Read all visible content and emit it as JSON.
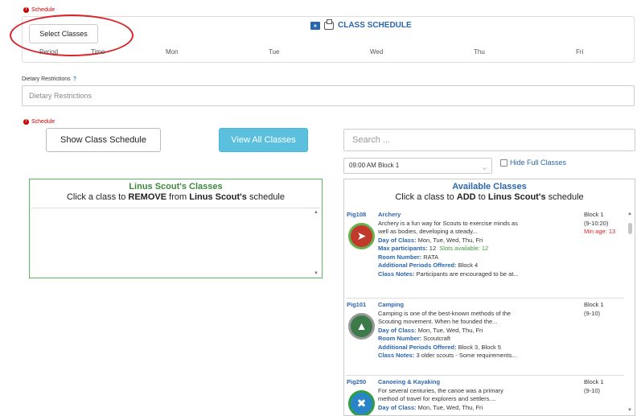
{
  "top": {
    "req_label": "Schedule",
    "select_classes": "Select Classes",
    "schedule_title": "CLASS SCHEDULE",
    "headers": [
      "Period",
      "Time",
      "Mon",
      "Tue",
      "Wed",
      "Thu",
      "Fri"
    ]
  },
  "dietary": {
    "label": "Dietary Restrictions",
    "help": "?",
    "placeholder": "Dietary Restrictions"
  },
  "schedule": {
    "req_label": "Schedule",
    "show_button": "Show Class Schedule",
    "view_all_button": "View All Classes",
    "search_placeholder": "Search ...",
    "block_select": "09:00 AM Block 1",
    "hide_full": "Hide Full Classes"
  },
  "my_classes": {
    "title": "Linus Scout's Classes",
    "sub_pre": "Click a class to ",
    "sub_verb": "REMOVE",
    "sub_mid": " from ",
    "sub_name": "Linus Scout's",
    "sub_post": " schedule"
  },
  "available": {
    "title": "Available Classes",
    "sub_pre": "Click a class to ",
    "sub_verb": "ADD",
    "sub_mid": " to ",
    "sub_name": "Linus Scout's",
    "sub_post": " schedule",
    "classes": [
      {
        "code": "Pig108",
        "name": "Archery",
        "desc1": "Archery is a fun way for Scouts to exercise minds as",
        "desc2": "well as bodies, developing a steady...",
        "day_label": "Day of Class:",
        "day_value": " Mon, Tue, Wed, Thu, Fri",
        "max_label": "Max participants:",
        "max_value": " 12",
        "slots": "Slots available: 12",
        "room_label": "Room Number:",
        "room_value": " RATA",
        "addl_label": "Additional Periods Offered:",
        "addl_value": " Block 4",
        "notes_label": "Class Notes:",
        "notes_value": " Participants are encouraged to be at...",
        "block": "Block 1",
        "time": "(9-10:20)",
        "min_age": "Min age: 13",
        "badge_color": "#c0392b",
        "ring_color": "#6ab04c"
      },
      {
        "code": "Pig101",
        "name": "Camping",
        "desc1": "Camping is one of the best-known methods of the",
        "desc2": "Scouting movement. When he founded the...",
        "day_label": "Day of Class:",
        "day_value": " Mon, Tue, Wed, Thu, Fri",
        "room_label": "Room Number:",
        "room_value": " Scoutcraft",
        "addl_label": "Additional Periods Offered:",
        "addl_value": " Block 3, Block 5",
        "notes_label": "Class Notes:",
        "notes_value": " 3 older scouts - Some requirements...",
        "block": "Block 1",
        "time": "(9-10)",
        "badge_color": "#3d7a4a",
        "ring_color": "#999999"
      },
      {
        "code": "Pig250",
        "name": "Canoeing & Kayaking",
        "desc1": "For several centuries, the canoe was a primary",
        "desc2": "method of travel for explorers and settlers....",
        "day_label": "Day of Class:",
        "day_value": " Mon, Tue, Wed, Thu, Fri",
        "block": "Block 1",
        "time": "(9-10)",
        "badge_color": "#2a85c8",
        "ring_color": "#2f9e44"
      }
    ]
  }
}
